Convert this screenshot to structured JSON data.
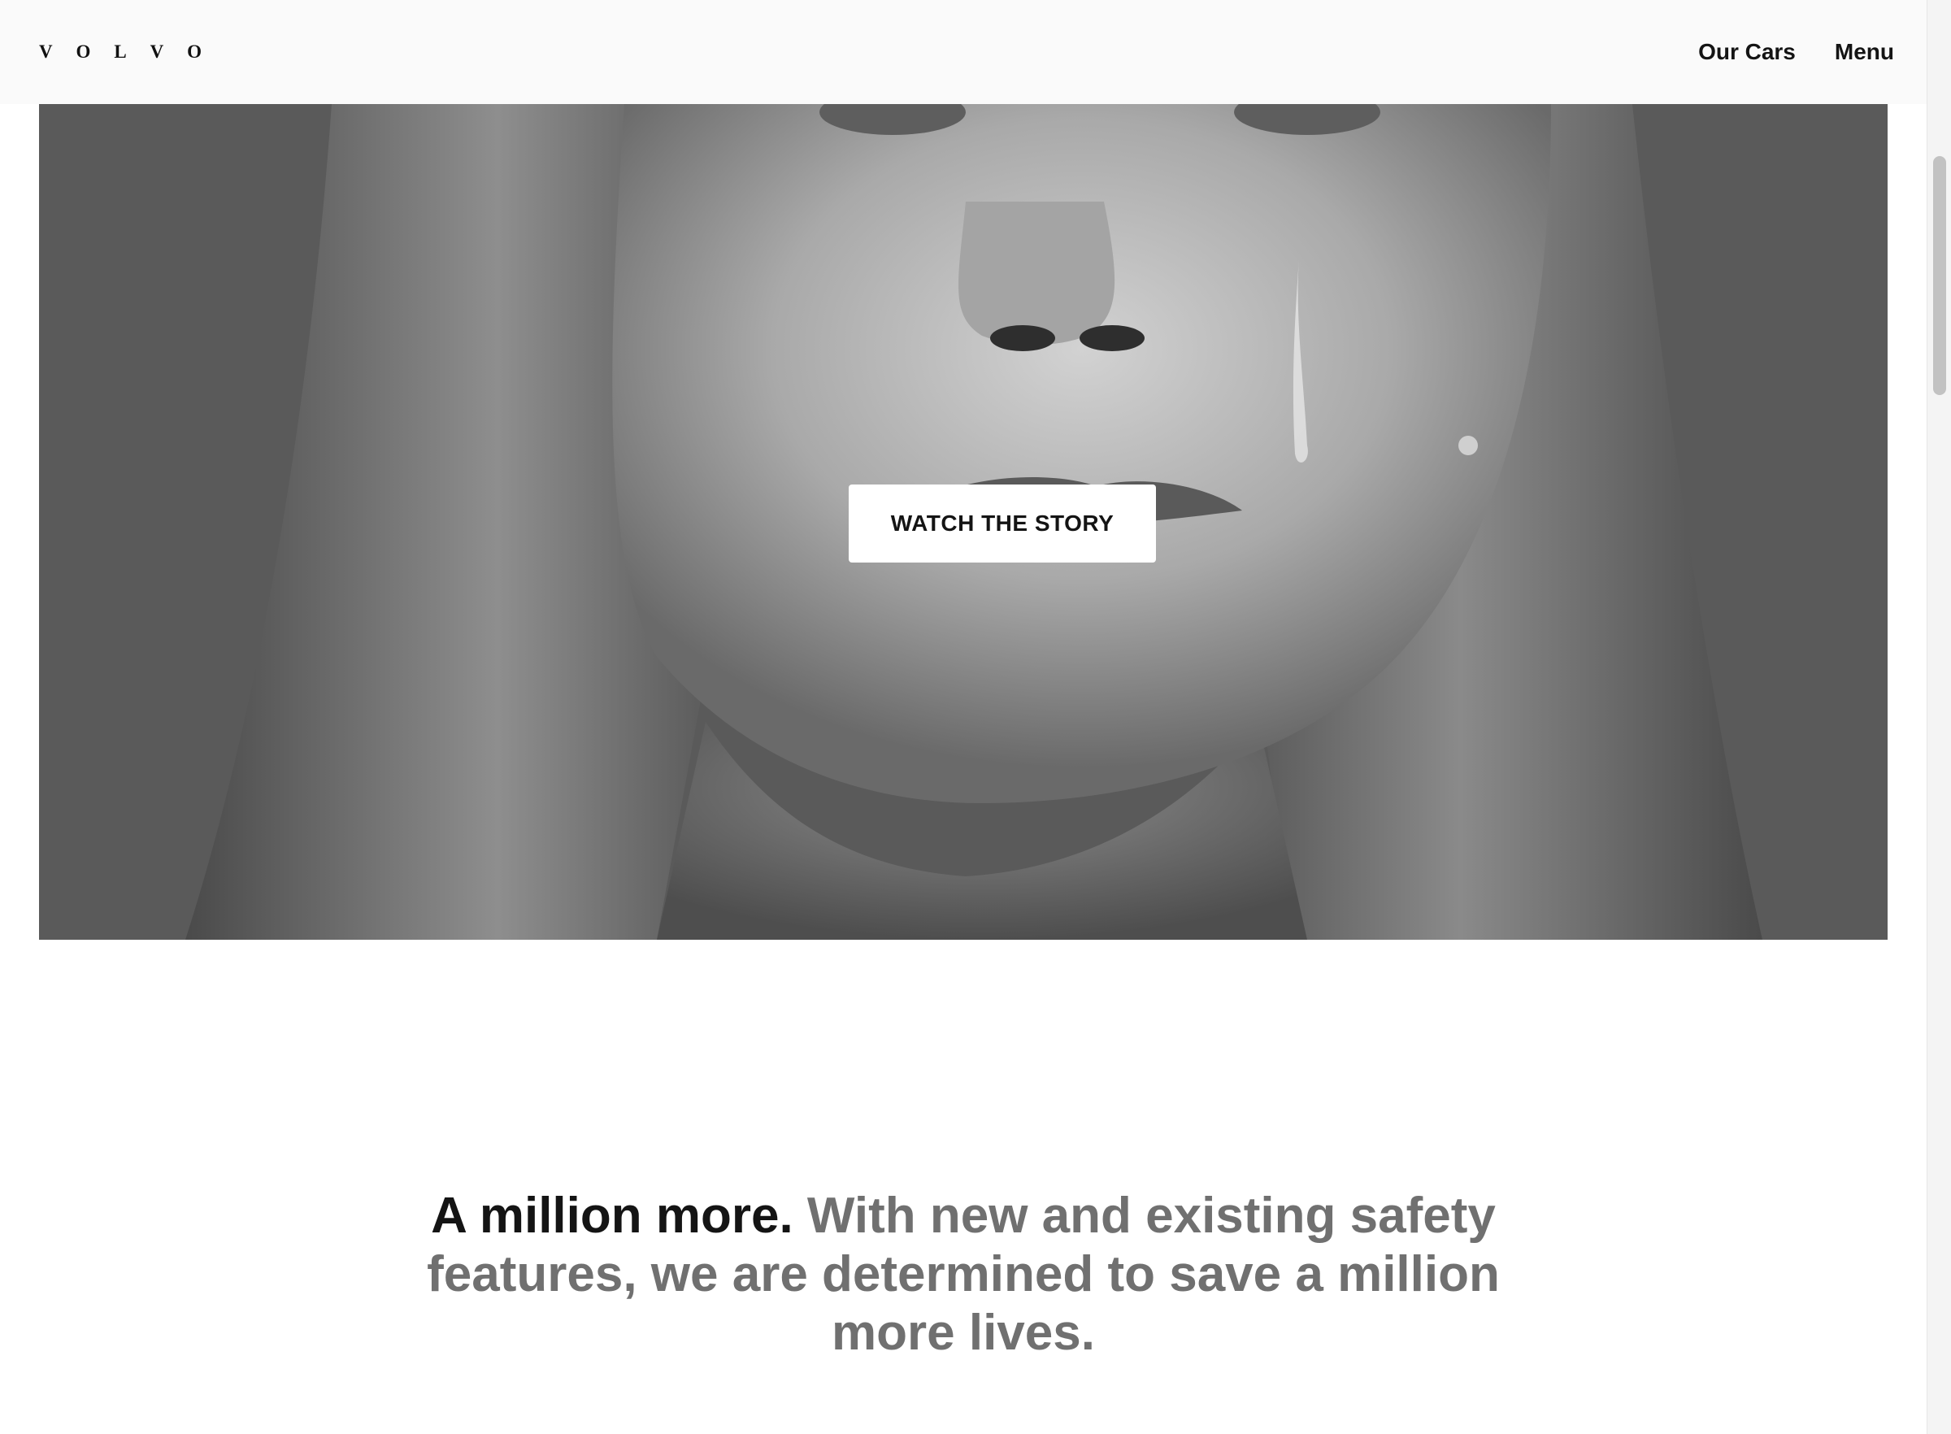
{
  "header": {
    "logo_letters": [
      "V",
      "O",
      "L",
      "V",
      "O"
    ],
    "nav": {
      "our_cars": "Our Cars",
      "menu": "Menu"
    }
  },
  "hero": {
    "image_subject": "black-and-white close-up portrait of a girl with a tear",
    "button_label": "WATCH THE STORY"
  },
  "statement": {
    "lead": "A million more.",
    "body": " With new and existing safety features, we are determined to save a million more lives."
  },
  "colors": {
    "header_bg": "#fafafa",
    "text_dark": "#141414",
    "text_gray": "#707070",
    "button_bg": "#ffffff"
  }
}
